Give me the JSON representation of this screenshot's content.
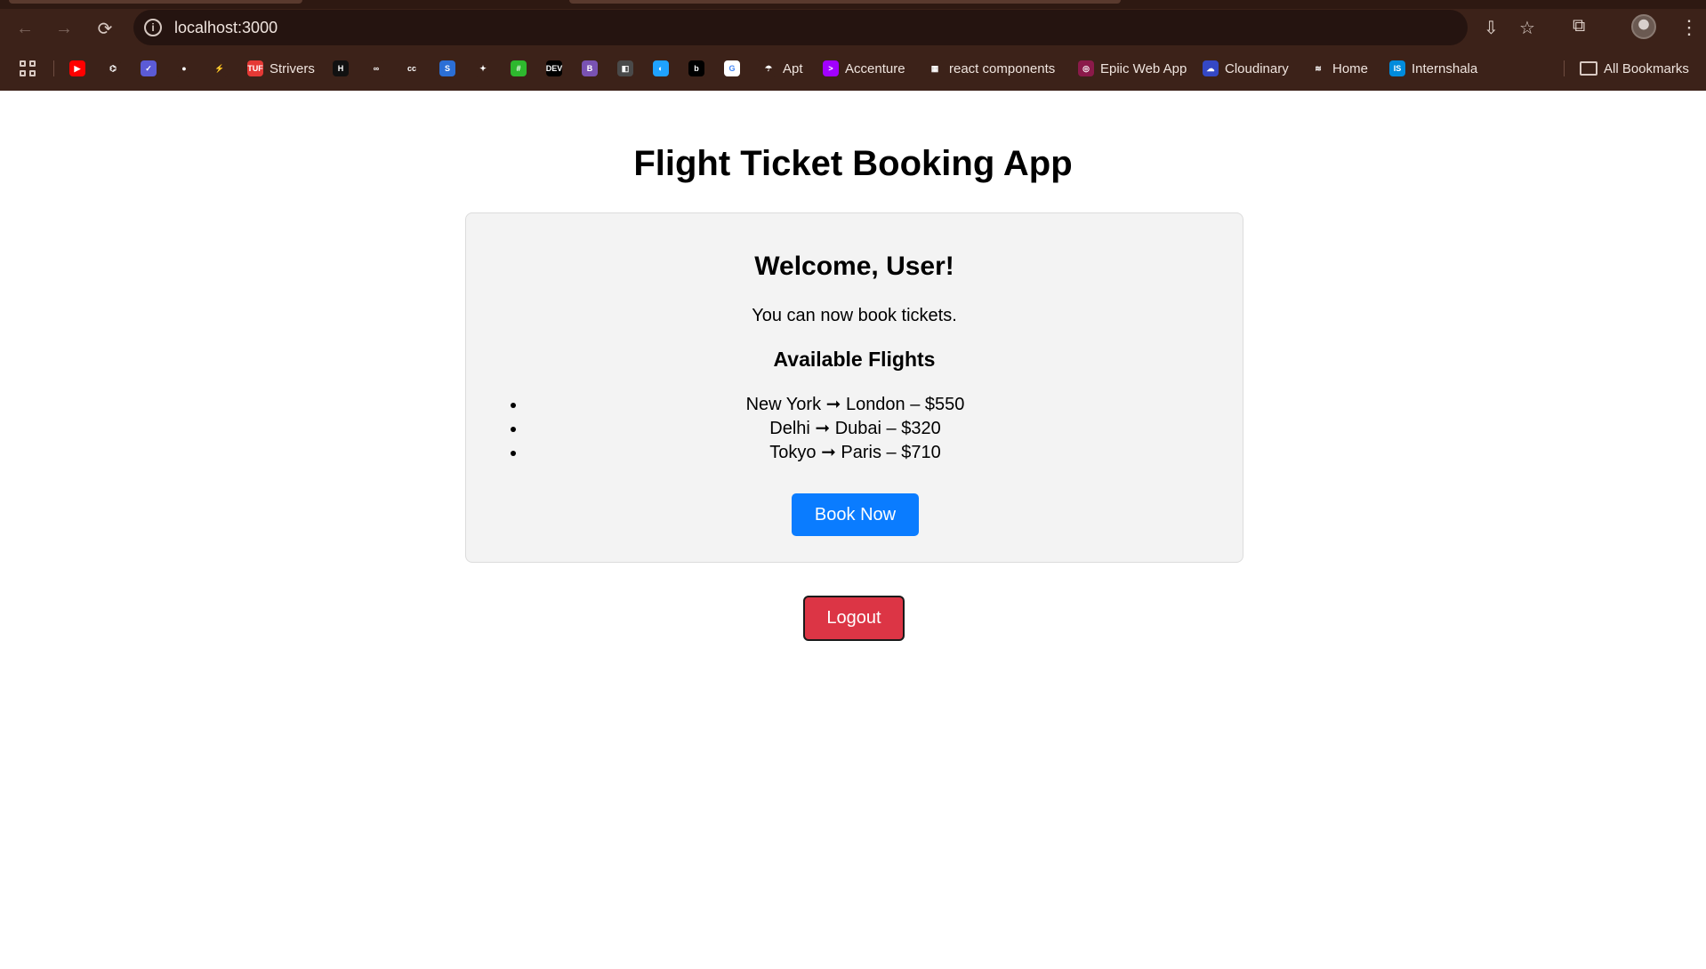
{
  "browser": {
    "url": "localhost:3000",
    "bookmarks": [
      {
        "label": "",
        "icon": "youtube-icon",
        "color": "#ff0000",
        "glyph": "▶"
      },
      {
        "label": "",
        "icon": "openai-icon",
        "color": "#3c2219",
        "glyph": "⌬"
      },
      {
        "label": "",
        "icon": "bookmark-icon-3",
        "color": "#5b5bd6",
        "glyph": "✓"
      },
      {
        "label": "",
        "icon": "github-icon",
        "color": "#3c2219",
        "glyph": "●"
      },
      {
        "label": "",
        "icon": "bookmark-icon-5",
        "color": "#3c2219",
        "glyph": "⚡"
      },
      {
        "label": "Strivers",
        "icon": "tuf-icon",
        "color": "#e53935",
        "glyph": "TUF"
      },
      {
        "label": "",
        "icon": "hackerrank-icon",
        "color": "#111111",
        "glyph": "H"
      },
      {
        "label": "",
        "icon": "geeksforgeeks-icon",
        "color": "#3c2219",
        "glyph": "∞"
      },
      {
        "label": "",
        "icon": "codechef-icon",
        "color": "#3c2219",
        "glyph": "cc"
      },
      {
        "label": "",
        "icon": "bookmark-icon-10",
        "color": "#2b6fd6",
        "glyph": "S"
      },
      {
        "label": "",
        "icon": "figma-icon",
        "color": "#3c2219",
        "glyph": "✦"
      },
      {
        "label": "",
        "icon": "bookmark-icon-12",
        "color": "#2eb82e",
        "glyph": "#"
      },
      {
        "label": "",
        "icon": "dev-icon",
        "color": "#000000",
        "glyph": "DEV"
      },
      {
        "label": "",
        "icon": "bootstrap-icon",
        "color": "#7952b3",
        "glyph": "B"
      },
      {
        "label": "",
        "icon": "bookmark-icon-15",
        "color": "#4a4a4a",
        "glyph": "◧"
      },
      {
        "label": "",
        "icon": "bookmark-icon-16",
        "color": "#1fa2ff",
        "glyph": "◐"
      },
      {
        "label": "",
        "icon": "bookmark-icon-17",
        "color": "#000000",
        "glyph": "b"
      },
      {
        "label": "",
        "icon": "google-icon",
        "color": "#ffffff",
        "glyph": "G"
      },
      {
        "label": "Apt",
        "icon": "apt-icon",
        "color": "#3c2219",
        "glyph": "☂"
      },
      {
        "label": "Accenture",
        "icon": "accenture-icon",
        "color": "#a100ff",
        "glyph": ">"
      },
      {
        "label": "react components",
        "icon": "react-components-icon",
        "color": "#3c2219",
        "glyph": "▦"
      },
      {
        "label": "Epiic Web App",
        "icon": "epiic-icon",
        "color": "#8b1a4a",
        "glyph": "◎"
      },
      {
        "label": "Cloudinary",
        "icon": "cloudinary-icon",
        "color": "#3448c5",
        "glyph": "☁"
      },
      {
        "label": "Home",
        "icon": "home-bookmark-icon",
        "color": "#3c2219",
        "glyph": "≋"
      },
      {
        "label": "Internshala",
        "icon": "internshala-icon",
        "color": "#008bdc",
        "glyph": "IS"
      }
    ],
    "all_bookmarks_label": "All Bookmarks"
  },
  "app": {
    "title": "Flight Ticket Booking App",
    "welcome": "Welcome, User!",
    "subtitle": "You can now book tickets.",
    "flights_heading": "Available Flights",
    "flights": [
      "New York ➞ London – $550",
      "Delhi ➞ Dubai – $320",
      "Tokyo ➞ Paris – $710"
    ],
    "book_button": "Book Now",
    "logout_button": "Logout"
  }
}
